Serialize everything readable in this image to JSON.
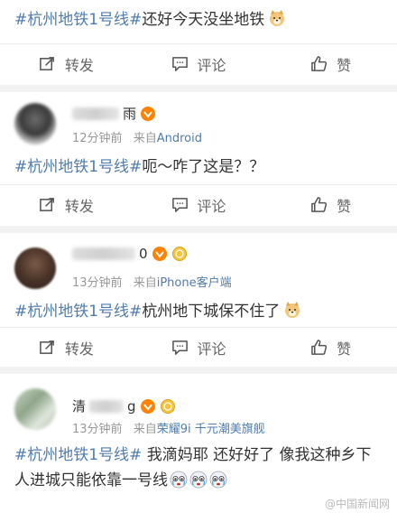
{
  "actions": {
    "repost": "转发",
    "comment": "评论",
    "like": "赞"
  },
  "post0": {
    "hashtag": "#杭州地铁1号线#",
    "text": "还好今天没坐地铁"
  },
  "post1": {
    "username": "雨",
    "time": "12分钟前",
    "source_prefix": "来自",
    "source": "Android",
    "hashtag": "#杭州地铁1号线#",
    "text": "呃～咋了这是？？"
  },
  "post2": {
    "username": "0",
    "time": "13分钟前",
    "source_prefix": "来自",
    "source": "iPhone客户端",
    "hashtag": "#杭州地铁1号线#",
    "text": "杭州地下城保不住了"
  },
  "post3": {
    "username_a": "清",
    "username_b": "g",
    "time": "13分钟前",
    "source_prefix": "来自",
    "source": "荣耀9i 千元潮美旗舰",
    "hashtag": "#杭州地铁1号线#",
    "text_line1": " 我滴妈耶 还好好了 像我这种乡下",
    "text_line2": "人进城只能依靠一号线"
  },
  "watermark": "@中国新闻网",
  "colors": {
    "link": "#507daf",
    "text": "#333333",
    "meta": "#999999",
    "background": "#f2f2f2"
  }
}
